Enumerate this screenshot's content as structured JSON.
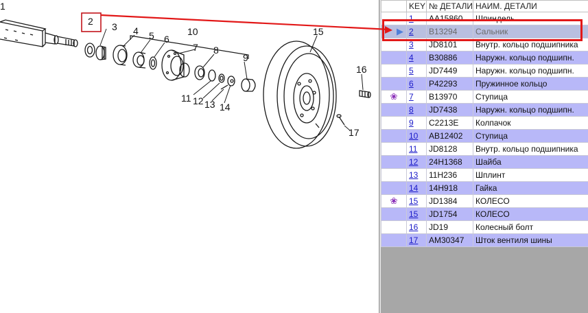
{
  "diagram": {
    "callouts": [
      "1",
      "2",
      "3",
      "4",
      "5",
      "6",
      "7",
      "8",
      "9",
      "10",
      "11",
      "12",
      "13",
      "14",
      "15",
      "16",
      "17"
    ],
    "highlighted_callout": "2"
  },
  "table": {
    "headers": {
      "indicator": "",
      "key": "KEY",
      "part_number": "№ ДЕТАЛИ",
      "part_name": "НАИМ. ДЕТАЛИ"
    },
    "rows": [
      {
        "key": "1",
        "part_number": "AA15860",
        "part_name": "Шпиндель"
      },
      {
        "key": "2",
        "part_number": "B13294",
        "part_name": "Сальник",
        "selected": true,
        "indicator": "pointer-icon"
      },
      {
        "key": "3",
        "part_number": "JD8101",
        "part_name": "Внутр. кольцо подшипника"
      },
      {
        "key": "4",
        "part_number": "B30886",
        "part_name": "Наружн. кольцо подшипн."
      },
      {
        "key": "5",
        "part_number": "JD7449",
        "part_name": "Наружн. кольцо подшипн."
      },
      {
        "key": "6",
        "part_number": "P42293",
        "part_name": "Пружинное кольцо"
      },
      {
        "key": "7",
        "part_number": "B13970",
        "part_name": "Ступица",
        "indicator": "flower-icon"
      },
      {
        "key": "8",
        "part_number": "JD7438",
        "part_name": "Наружн. кольцо подшипн."
      },
      {
        "key": "9",
        "part_number": "C2213E",
        "part_name": "Колпачок"
      },
      {
        "key": "10",
        "part_number": "AB12402",
        "part_name": "Ступица"
      },
      {
        "key": "11",
        "part_number": "JD8128",
        "part_name": "Внутр. кольцо подшипника"
      },
      {
        "key": "12",
        "part_number": "24H1368",
        "part_name": "Шайба"
      },
      {
        "key": "13",
        "part_number": "11H236",
        "part_name": "Шплинт"
      },
      {
        "key": "14",
        "part_number": "14H918",
        "part_name": "Гайка"
      },
      {
        "key": "15",
        "part_number": "JD1384",
        "part_name": "КОЛЕСО",
        "indicator": "flower-icon"
      },
      {
        "key": "15",
        "part_number": "JD1754",
        "part_name": "КОЛЕСО"
      },
      {
        "key": "16",
        "part_number": "JD19",
        "part_name": "Колесный болт"
      },
      {
        "key": "17",
        "part_number": "AM30347",
        "part_name": "Шток вентиля шины"
      }
    ]
  },
  "colors": {
    "highlight": "#e21818",
    "row_alt": "#b8b8f8",
    "row_plain": "#ffffff",
    "row_selected": "#b9bfe0",
    "link": "#1a1ac8",
    "flower": "#8a2fb8"
  }
}
